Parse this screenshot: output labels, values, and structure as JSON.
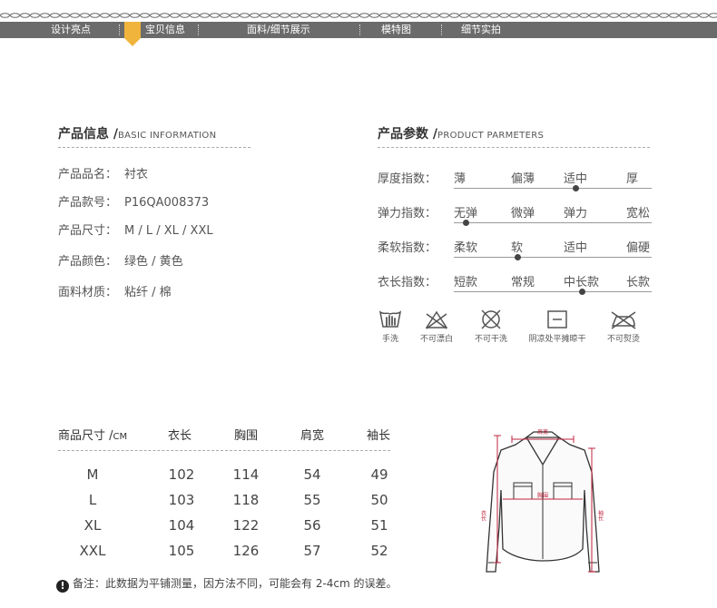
{
  "nav": {
    "items": [
      "设计亮点",
      "宝贝信息",
      "面料/细节展示",
      "模特图",
      "细节实拍"
    ],
    "active_index": 1,
    "accent_color": "#f0b43c",
    "bar_color": "#6b6b6b"
  },
  "basic_info": {
    "title": "产品信息 /",
    "subtitle": "BASIC INFORMATION",
    "rows": [
      {
        "label": "产品品名：",
        "value": "衬衣"
      },
      {
        "label": "产品款号：",
        "value": "P16QA008373"
      },
      {
        "label": "产品尺寸：",
        "value": "M / L / XL / XXL"
      },
      {
        "label": "产品颜色：",
        "value": "绿色 / 黄色"
      },
      {
        "label": "面料材质：",
        "value": "粘纤 / 棉"
      }
    ]
  },
  "params": {
    "title": "产品参数 /",
    "subtitle": "PRODUCT PARMETERS",
    "rows": [
      {
        "label": "厚度指数：",
        "options": [
          "薄",
          "偏薄",
          "适中",
          "厚"
        ],
        "selected_index": 2
      },
      {
        "label": "弹力指数：",
        "options": [
          "无弹",
          "微弹",
          "弹力",
          "宽松"
        ],
        "selected_index": 0
      },
      {
        "label": "柔软指数：",
        "options": [
          "柔软",
          "软",
          "适中",
          "偏硬"
        ],
        "selected_index": 1
      },
      {
        "label": "衣长指数：",
        "options": [
          "短款",
          "常规",
          "中长款",
          "长款"
        ],
        "selected_index": 2
      }
    ]
  },
  "care": [
    {
      "icon": "hand-wash-icon",
      "label": "手洗"
    },
    {
      "icon": "no-bleach-icon",
      "label": "不可漂白"
    },
    {
      "icon": "no-dry-clean-icon",
      "label": "不可干洗"
    },
    {
      "icon": "dry-flat-shade-icon",
      "label": "阴凉处平摊晾干"
    },
    {
      "icon": "no-iron-icon",
      "label": "不可熨烫"
    }
  ],
  "size_table": {
    "title": "商品尺寸 /",
    "unit": "CM",
    "headers": [
      "衣长",
      "胸围",
      "肩宽",
      "袖长"
    ],
    "rows": [
      {
        "size": "M",
        "values": [
          "102",
          "114",
          "54",
          "49"
        ]
      },
      {
        "size": "L",
        "values": [
          "103",
          "118",
          "55",
          "50"
        ]
      },
      {
        "size": "XL",
        "values": [
          "104",
          "122",
          "56",
          "51"
        ]
      },
      {
        "size": "XXL",
        "values": [
          "105",
          "126",
          "57",
          "52"
        ]
      }
    ]
  },
  "note": {
    "icon": "exclamation-icon",
    "text": "备注：此数据为平铺测量，因方法不同，可能会有 2-4cm 的误差。"
  },
  "diagram": {
    "shoulder_label": "肩宽",
    "chest_label": "胸围",
    "length_label": "衣长",
    "sleeve_label": "袖长",
    "measure_color": "#c0243c"
  }
}
